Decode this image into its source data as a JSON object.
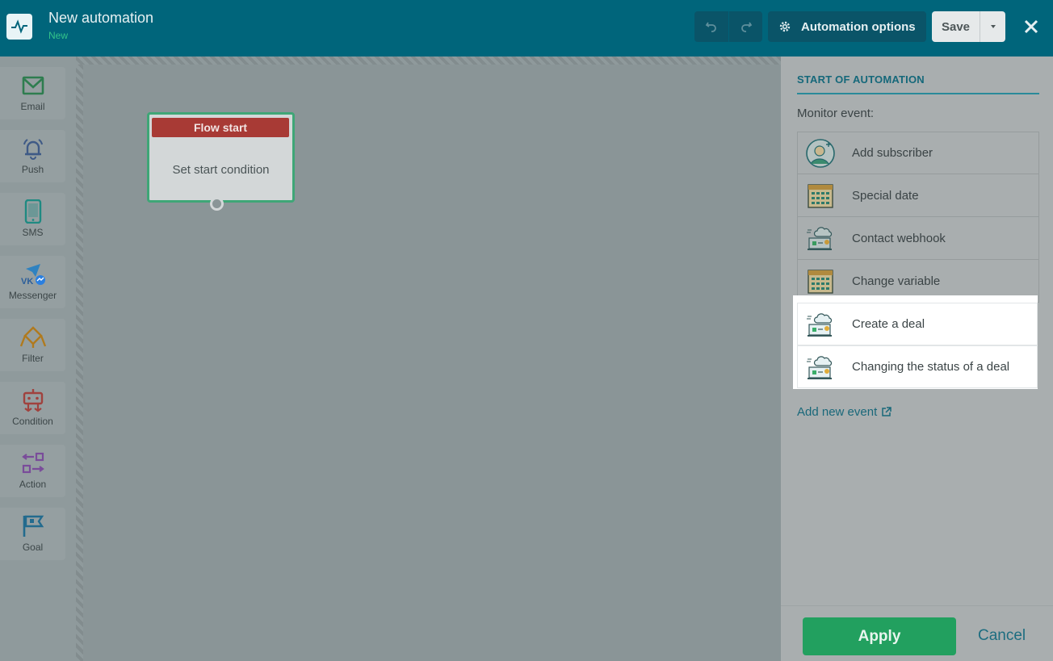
{
  "header": {
    "title": "New automation",
    "status": "New",
    "options_label": "Automation options",
    "save_label": "Save"
  },
  "tools": [
    {
      "label": "Email",
      "icon": "email-icon",
      "color": "#2e7d4f"
    },
    {
      "label": "Push",
      "icon": "bell-icon",
      "color": "#3f5a86"
    },
    {
      "label": "SMS",
      "icon": "phone-icon",
      "color": "#1f8a82"
    },
    {
      "label": "Messenger",
      "icon": "messenger-icon",
      "color": "#2a6db5"
    },
    {
      "label": "Filter",
      "icon": "filter-icon",
      "color": "#b07a1e"
    },
    {
      "label": "Condition",
      "icon": "condition-icon",
      "color": "#a0423e"
    },
    {
      "label": "Action",
      "icon": "action-icon",
      "color": "#7a4c9a"
    },
    {
      "label": "Goal",
      "icon": "goal-flag-icon",
      "color": "#236b8e"
    }
  ],
  "flow_node": {
    "title": "Flow start",
    "body": "Set start condition"
  },
  "panel": {
    "title": "START OF AUTOMATION",
    "monitor_label": "Monitor event:",
    "events": [
      {
        "label": "Add subscriber",
        "icon": "add-subscriber-icon"
      },
      {
        "label": "Special date",
        "icon": "calendar-icon"
      },
      {
        "label": "Contact webhook",
        "icon": "webhook-icon"
      },
      {
        "label": "Change variable",
        "icon": "calendar-icon"
      },
      {
        "label": "Create a deal",
        "icon": "webhook-icon"
      },
      {
        "label": "Changing the status of a deal",
        "icon": "webhook-icon"
      }
    ],
    "add_event_label": "Add new event",
    "apply_label": "Apply",
    "cancel_label": "Cancel"
  }
}
